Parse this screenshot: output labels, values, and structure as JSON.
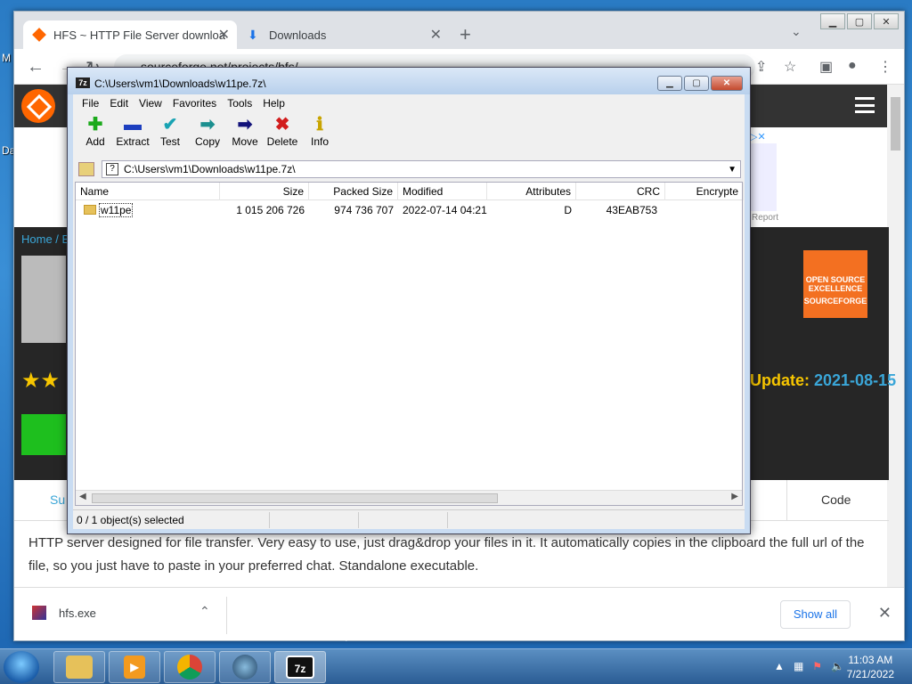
{
  "desktop": {
    "label_1": "M",
    "label_2": "Da"
  },
  "chrome": {
    "tabs": [
      {
        "title": "HFS ~ HTTP File Server downloa"
      },
      {
        "title": "Downloads"
      }
    ],
    "url": "sourceforge.net/projects/hfs/",
    "page": {
      "breadcrumb": "Home / Br",
      "ad_report": "Report",
      "badge_text_1": "OPEN SOURCE",
      "badge_text_2": "EXCELLENCE",
      "badge_text_3": "SOURCEFORGE",
      "update_label": "Update:",
      "update_date": "2021-08-15",
      "tab_left": "Su",
      "tab_code": "Code",
      "description": "HTTP server designed for file transfer. Very easy to use, just drag&drop your files in it. It automatically copies in the clipboard the full url of the file, so you just have to paste in your preferred chat. Standalone executable."
    },
    "download_bar": {
      "file": "hfs.exe",
      "show_all": "Show all"
    }
  },
  "sevenzip": {
    "title": "C:\\Users\\vm1\\Downloads\\w11pe.7z\\",
    "icon_text": "7z",
    "menu": [
      "File",
      "Edit",
      "View",
      "Favorites",
      "Tools",
      "Help"
    ],
    "toolbar": [
      {
        "label": "Add",
        "icon": "plus-icon",
        "glyph": "✚",
        "color": "#1caa1c"
      },
      {
        "label": "Extract",
        "icon": "minus-icon",
        "glyph": "▬",
        "color": "#1d3fbf"
      },
      {
        "label": "Test",
        "icon": "check-icon",
        "glyph": "✔",
        "color": "#19a3b3"
      },
      {
        "label": "Copy",
        "icon": "copy-arrow-icon",
        "glyph": "➡",
        "color": "#1b8f8f"
      },
      {
        "label": "Move",
        "icon": "move-arrow-icon",
        "glyph": "➡",
        "color": "#12127a"
      },
      {
        "label": "Delete",
        "icon": "delete-x-icon",
        "glyph": "✖",
        "color": "#d21d1d"
      },
      {
        "label": "Info",
        "icon": "info-icon",
        "glyph": "ℹ",
        "color": "#c8a400"
      }
    ],
    "address": "C:\\Users\\vm1\\Downloads\\w11pe.7z\\",
    "columns": [
      "Name",
      "Size",
      "Packed Size",
      "Modified",
      "Attributes",
      "CRC",
      "Encrypte"
    ],
    "rows": [
      {
        "name": "w11pe",
        "size": "1 015 206 726",
        "packed": "974 736 707",
        "modified": "2022-07-14 04:21",
        "attributes": "D",
        "crc": "43EAB753",
        "encrypted": ""
      }
    ],
    "status": "0 / 1 object(s) selected"
  },
  "taskbar": {
    "time": "11:03 AM",
    "date": "7/21/2022",
    "sevenzip_label": "7z"
  }
}
